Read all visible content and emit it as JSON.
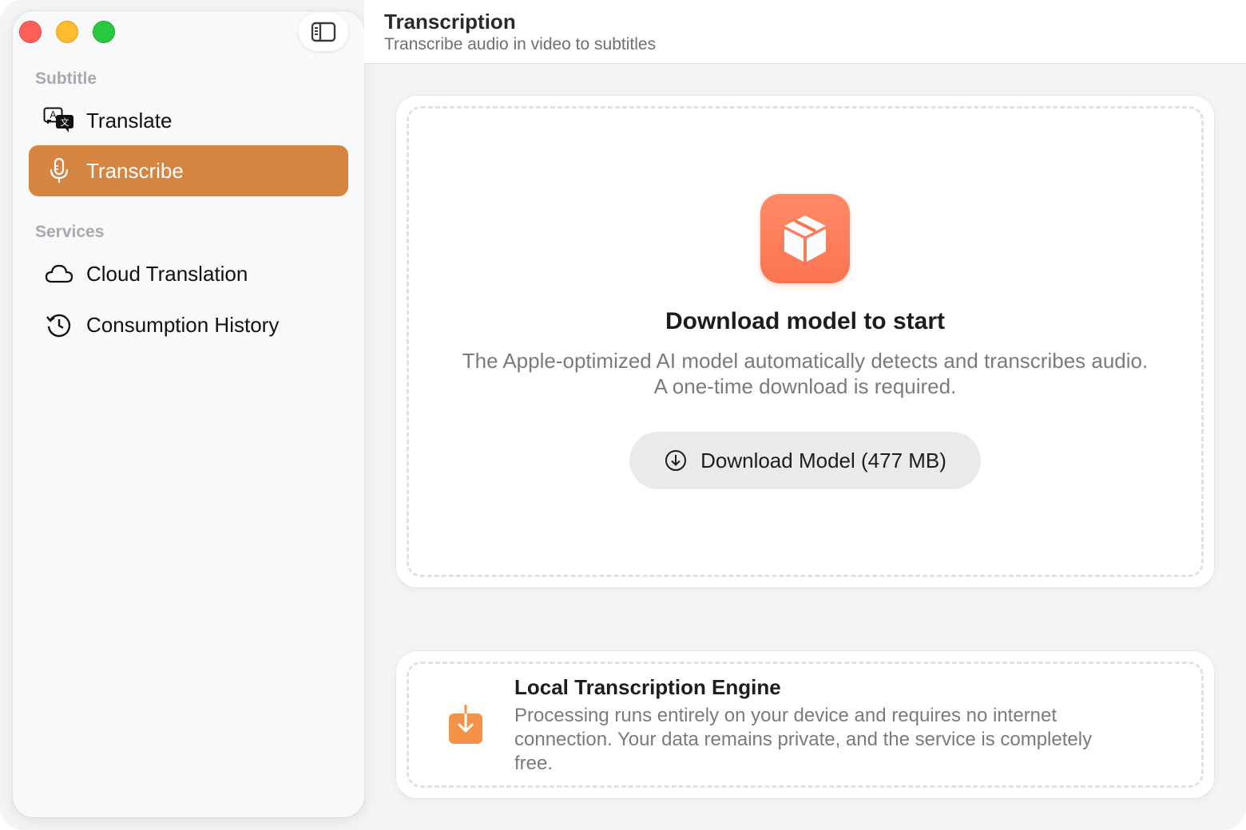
{
  "header": {
    "title": "Transcription",
    "subtitle": "Transcribe audio in video to subtitles"
  },
  "sidebar": {
    "sections": [
      {
        "label": "Subtitle",
        "items": [
          {
            "label": "Translate",
            "icon": "translate-icon",
            "active": false
          },
          {
            "label": "Transcribe",
            "icon": "microphone-icon",
            "active": true
          }
        ]
      },
      {
        "label": "Services",
        "items": [
          {
            "label": "Cloud Translation",
            "icon": "cloud-icon",
            "active": false
          },
          {
            "label": "Consumption History",
            "icon": "history-icon",
            "active": false
          }
        ]
      }
    ]
  },
  "main": {
    "title": "Download model to start",
    "description": "The Apple-optimized AI model automatically detects and transcribes audio. A one-time download is required.",
    "download_button": "Download Model (477 MB)",
    "icon": "package-icon"
  },
  "engine": {
    "title": "Local Transcription Engine",
    "description": "Processing runs entirely on your device and requires no internet connection. Your data remains private, and the service is completely free.",
    "icon": "download-tray-icon"
  },
  "colors": {
    "accent": "#d58540",
    "model_icon": "#fb7452",
    "engine_icon": "#f5924a"
  }
}
